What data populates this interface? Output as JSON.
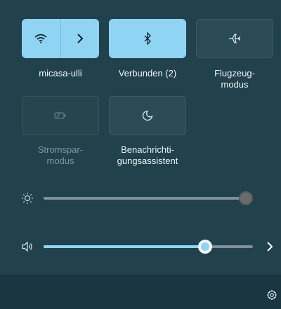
{
  "tiles": [
    {
      "name": "wifi",
      "label": "micasa-ulli",
      "state": "on"
    },
    {
      "name": "bluetooth",
      "label": "Verbunden (2)",
      "state": "on"
    },
    {
      "name": "airplane",
      "label": "Flugzeug-\nmodus",
      "label_lines": [
        "Flugzeug-",
        "modus"
      ],
      "state": "off"
    },
    {
      "name": "battery-saver",
      "label_lines": [
        "Stromspar-",
        "modus"
      ],
      "state": "disabled"
    },
    {
      "name": "focus-assist",
      "label_lines": [
        "Benachrichti-",
        "gungsassistent"
      ],
      "state": "off"
    }
  ],
  "brightness": {
    "level": 1.0,
    "icon": "sun-icon"
  },
  "volume": {
    "level": 0.8,
    "icon": "speaker-icon"
  },
  "colors": {
    "accent": "#8fd4f2",
    "background": "#21414d",
    "thumb_dark": "#6b6b6b"
  },
  "footer": {
    "icon": "settings-icon"
  }
}
